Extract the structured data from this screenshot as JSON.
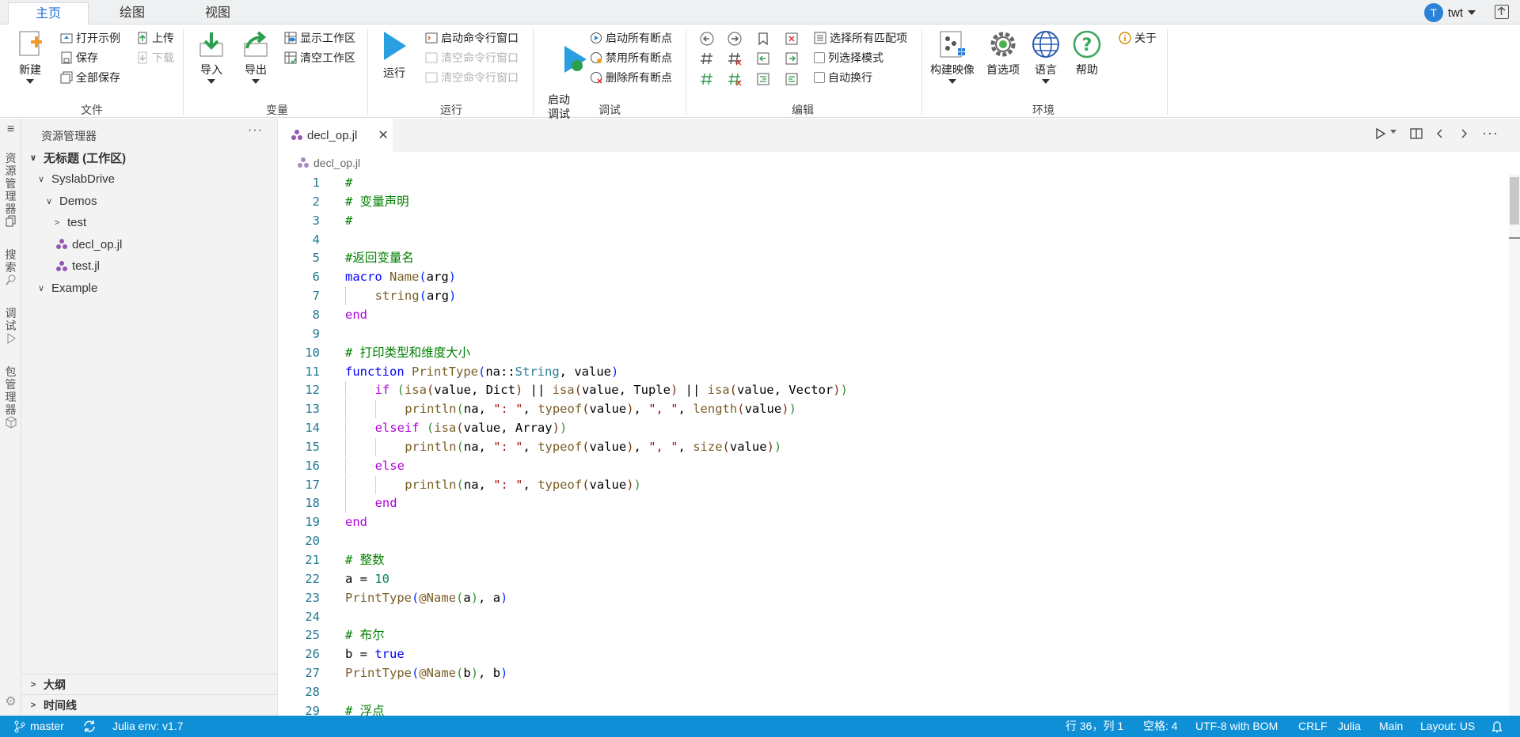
{
  "ribbon": {
    "tabs": [
      {
        "label": "主页",
        "active": true
      },
      {
        "label": "绘图",
        "active": false
      },
      {
        "label": "视图",
        "active": false
      }
    ],
    "user": {
      "initial": "T",
      "name": "twt"
    },
    "groups": {
      "file": {
        "label": "文件",
        "new": "新建",
        "open_example": "打开示例",
        "save": "保存",
        "save_all": "全部保存",
        "upload": "上传",
        "download": "下载"
      },
      "variables": {
        "label": "变量",
        "import": "导入",
        "export": "导出",
        "show_workspace": "显示工作区",
        "clear_workspace": "清空工作区"
      },
      "run": {
        "label": "运行",
        "run": "运行",
        "start_cmd": "启动命令行窗口",
        "clear_cmd1": "清空命令行窗口",
        "clear_cmd2": "清空命令行窗口"
      },
      "debug": {
        "label": "调试",
        "start_debug": "启动\n调试",
        "enable_all": "启动所有断点",
        "disable_all": "禁用所有断点",
        "delete_all": "删除所有断点"
      },
      "edit": {
        "label": "编辑",
        "select_all_matches": "选择所有匹配项",
        "column_select": "列选择模式",
        "word_wrap": "自动换行"
      },
      "environment": {
        "label": "环境",
        "build_image": "构建映像",
        "preferences": "首选项",
        "language": "语言",
        "help": "帮助",
        "about": "关于"
      }
    }
  },
  "activity_bar": [
    {
      "label": "资\n源\n管\n理\n器",
      "icon": "copy-icon"
    },
    {
      "label": "搜\n索",
      "icon": "search-icon"
    },
    {
      "label": "调\n试",
      "icon": "debug-icon"
    },
    {
      "label": "包\n管\n理\n器",
      "icon": "package-icon"
    }
  ],
  "explorer": {
    "title": "资源管理器",
    "more": "···",
    "tree": [
      {
        "label": "无标题 (工作区)",
        "depth": 0,
        "kind": "open",
        "bold": true
      },
      {
        "label": "SyslabDrive",
        "depth": 1,
        "kind": "open"
      },
      {
        "label": "Demos",
        "depth": 2,
        "kind": "open"
      },
      {
        "label": "test",
        "depth": 3,
        "kind": "closed"
      },
      {
        "label": "decl_op.jl",
        "depth": 3,
        "kind": "file"
      },
      {
        "label": "test.jl",
        "depth": 3,
        "kind": "file"
      },
      {
        "label": "Example",
        "depth": 1,
        "kind": "open"
      }
    ],
    "sections": [
      "大纲",
      "时间线"
    ]
  },
  "editor": {
    "tab": {
      "label": "decl_op.jl",
      "close": "✕"
    },
    "breadcrumb": "decl_op.jl",
    "lines": [
      {
        "n": "1",
        "indent": 0,
        "tokens": [
          [
            "c",
            "#"
          ]
        ]
      },
      {
        "n": "2",
        "indent": 0,
        "tokens": [
          [
            "c",
            "# 变量声明"
          ]
        ]
      },
      {
        "n": "3",
        "indent": 0,
        "tokens": [
          [
            "c",
            "#"
          ]
        ]
      },
      {
        "n": "4",
        "indent": 0,
        "tokens": []
      },
      {
        "n": "5",
        "indent": 0,
        "tokens": [
          [
            "c",
            "#返回变量名"
          ]
        ]
      },
      {
        "n": "6",
        "indent": 0,
        "tokens": [
          [
            "kb",
            "macro "
          ],
          [
            "f",
            "Name"
          ],
          [
            "b1",
            "("
          ],
          [
            "",
            "arg"
          ],
          [
            "b1",
            ")"
          ]
        ]
      },
      {
        "n": "7",
        "indent": 1,
        "tokens": [
          [
            "f",
            "string"
          ],
          [
            "b1",
            "("
          ],
          [
            "",
            "arg"
          ],
          [
            "b1",
            ")"
          ]
        ]
      },
      {
        "n": "8",
        "indent": 0,
        "tokens": [
          [
            "k",
            "end"
          ]
        ]
      },
      {
        "n": "9",
        "indent": 0,
        "tokens": []
      },
      {
        "n": "10",
        "indent": 0,
        "tokens": [
          [
            "c",
            "# 打印类型和维度大小"
          ]
        ]
      },
      {
        "n": "11",
        "indent": 0,
        "tokens": [
          [
            "kb",
            "function "
          ],
          [
            "f",
            "PrintType"
          ],
          [
            "b1",
            "("
          ],
          [
            "",
            "na::"
          ],
          [
            "t",
            "String"
          ],
          [
            "",
            ", value"
          ],
          [
            "b1",
            ")"
          ]
        ]
      },
      {
        "n": "12",
        "indent": 1,
        "tokens": [
          [
            "k",
            "if "
          ],
          [
            "b2",
            "("
          ],
          [
            "f",
            "isa"
          ],
          [
            "b3",
            "("
          ],
          [
            "",
            "value, Dict"
          ],
          [
            "b3",
            ")"
          ],
          [
            "",
            " || "
          ],
          [
            "f",
            "isa"
          ],
          [
            "b3",
            "("
          ],
          [
            "",
            "value, Tuple"
          ],
          [
            "b3",
            ")"
          ],
          [
            "",
            " || "
          ],
          [
            "f",
            "isa"
          ],
          [
            "b3",
            "("
          ],
          [
            "",
            "value, Vector"
          ],
          [
            "b3",
            ")"
          ],
          [
            "b2",
            ")"
          ]
        ]
      },
      {
        "n": "13",
        "indent": 2,
        "tokens": [
          [
            "f",
            "println"
          ],
          [
            "b2",
            "("
          ],
          [
            "",
            "na, "
          ],
          [
            "s",
            "\": \""
          ],
          [
            "",
            ", "
          ],
          [
            "f",
            "typeof"
          ],
          [
            "b3",
            "("
          ],
          [
            "",
            "value"
          ],
          [
            "b3",
            ")"
          ],
          [
            "",
            ", "
          ],
          [
            "s",
            "\", \""
          ],
          [
            "",
            ", "
          ],
          [
            "f",
            "length"
          ],
          [
            "b3",
            "("
          ],
          [
            "",
            "value"
          ],
          [
            "b3",
            ")"
          ],
          [
            "b2",
            ")"
          ]
        ]
      },
      {
        "n": "14",
        "indent": 1,
        "tokens": [
          [
            "k",
            "elseif "
          ],
          [
            "b2",
            "("
          ],
          [
            "f",
            "isa"
          ],
          [
            "b3",
            "("
          ],
          [
            "",
            "value, Array"
          ],
          [
            "b3",
            ")"
          ],
          [
            "b2",
            ")"
          ]
        ]
      },
      {
        "n": "15",
        "indent": 2,
        "tokens": [
          [
            "f",
            "println"
          ],
          [
            "b2",
            "("
          ],
          [
            "",
            "na, "
          ],
          [
            "s",
            "\": \""
          ],
          [
            "",
            ", "
          ],
          [
            "f",
            "typeof"
          ],
          [
            "b3",
            "("
          ],
          [
            "",
            "value"
          ],
          [
            "b3",
            ")"
          ],
          [
            "",
            ", "
          ],
          [
            "s",
            "\", \""
          ],
          [
            "",
            ", "
          ],
          [
            "f",
            "size"
          ],
          [
            "b3",
            "("
          ],
          [
            "",
            "value"
          ],
          [
            "b3",
            ")"
          ],
          [
            "b2",
            ")"
          ]
        ]
      },
      {
        "n": "16",
        "indent": 1,
        "tokens": [
          [
            "k",
            "else"
          ]
        ]
      },
      {
        "n": "17",
        "indent": 2,
        "tokens": [
          [
            "f",
            "println"
          ],
          [
            "b2",
            "("
          ],
          [
            "",
            "na, "
          ],
          [
            "s",
            "\": \""
          ],
          [
            "",
            ", "
          ],
          [
            "f",
            "typeof"
          ],
          [
            "b3",
            "("
          ],
          [
            "",
            "value"
          ],
          [
            "b3",
            ")"
          ],
          [
            "b2",
            ")"
          ]
        ]
      },
      {
        "n": "18",
        "indent": 1,
        "tokens": [
          [
            "k",
            "end"
          ]
        ]
      },
      {
        "n": "19",
        "indent": 0,
        "tokens": [
          [
            "k",
            "end"
          ]
        ]
      },
      {
        "n": "20",
        "indent": 0,
        "tokens": []
      },
      {
        "n": "21",
        "indent": 0,
        "tokens": [
          [
            "c",
            "# 整数"
          ]
        ]
      },
      {
        "n": "22",
        "indent": 0,
        "tokens": [
          [
            "",
            "a = "
          ],
          [
            "n",
            "10"
          ]
        ]
      },
      {
        "n": "23",
        "indent": 0,
        "tokens": [
          [
            "f",
            "PrintType"
          ],
          [
            "b1",
            "("
          ],
          [
            "f",
            "@Name"
          ],
          [
            "b2",
            "("
          ],
          [
            "",
            "a"
          ],
          [
            "b2",
            ")"
          ],
          [
            "",
            ", a"
          ],
          [
            "b1",
            ")"
          ]
        ]
      },
      {
        "n": "24",
        "indent": 0,
        "tokens": []
      },
      {
        "n": "25",
        "indent": 0,
        "tokens": [
          [
            "c",
            "# 布尔"
          ]
        ]
      },
      {
        "n": "26",
        "indent": 0,
        "tokens": [
          [
            "",
            "b = "
          ],
          [
            "kb",
            "true"
          ]
        ]
      },
      {
        "n": "27",
        "indent": 0,
        "tokens": [
          [
            "f",
            "PrintType"
          ],
          [
            "b1",
            "("
          ],
          [
            "f",
            "@Name"
          ],
          [
            "b2",
            "("
          ],
          [
            "",
            "b"
          ],
          [
            "b2",
            ")"
          ],
          [
            "",
            ", b"
          ],
          [
            "b1",
            ")"
          ]
        ]
      },
      {
        "n": "28",
        "indent": 0,
        "tokens": []
      },
      {
        "n": "29",
        "indent": 0,
        "tokens": [
          [
            "c",
            "# 浮点"
          ]
        ]
      }
    ]
  },
  "status_bar": {
    "branch": "master",
    "env": "Julia env: v1.7",
    "position": "行 36，列 1",
    "spaces": "空格: 4",
    "encoding": "UTF-8 with BOM",
    "eol": "CRLF",
    "language": "Julia",
    "main": "Main",
    "layout": "Layout: US"
  },
  "colors": {
    "accent": "#1f6fd6",
    "status_bar": "#0e8fd6",
    "julia_purple": "#9558b2"
  }
}
